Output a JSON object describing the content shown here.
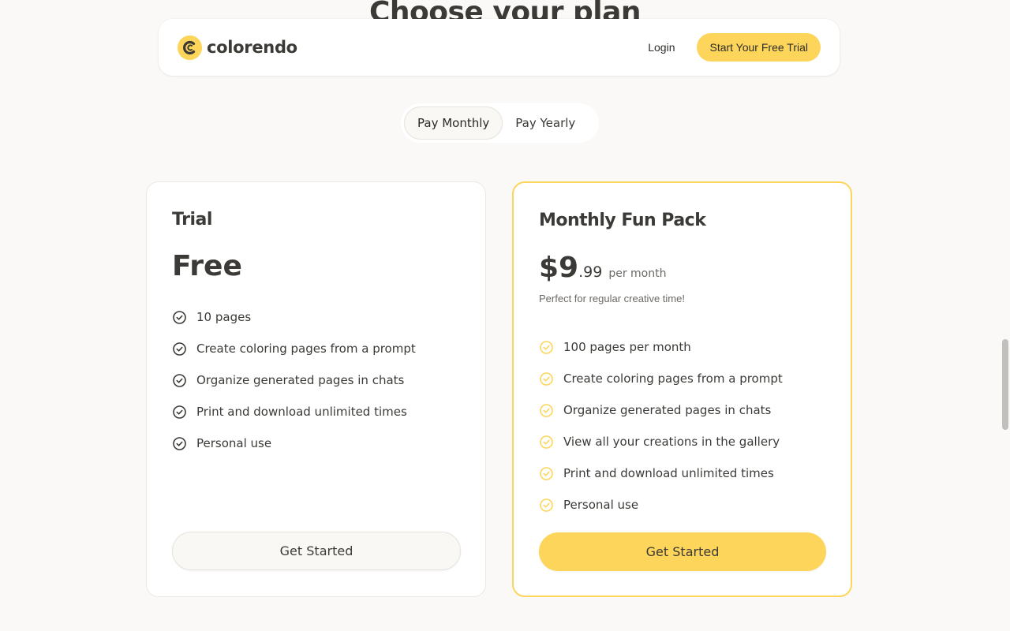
{
  "section": {
    "title": "Choose your plan"
  },
  "nav": {
    "brand": "colorendo",
    "login": "Login",
    "cta": "Start Your Free Trial"
  },
  "billing": {
    "monthly": "Pay Monthly",
    "yearly": "Pay Yearly",
    "selected": "Pay Monthly"
  },
  "plans": [
    {
      "name": "Trial",
      "price": "Free",
      "features": [
        "10 pages",
        "Create coloring pages from a prompt",
        "Organize generated pages in chats",
        "Print and download unlimited times",
        "Personal use"
      ],
      "cta": "Get Started"
    },
    {
      "name": "Monthly Fun Pack",
      "price_main": "$9",
      "price_cents": ".99",
      "price_period": "per month",
      "tagline": "Perfect for regular creative time!",
      "features": [
        "100 pages per month",
        "Create coloring pages from a prompt",
        "Organize generated pages in chats",
        "View all your creations in the gallery",
        "Print and download unlimited times",
        "Personal use"
      ],
      "cta": "Get Started"
    }
  ],
  "colors": {
    "accent": "#fcd55a",
    "background": "#fbf9f7",
    "text": "#3b3a36"
  },
  "icons": {
    "brand": "colorendo-logo",
    "check": "check-circle-icon"
  }
}
